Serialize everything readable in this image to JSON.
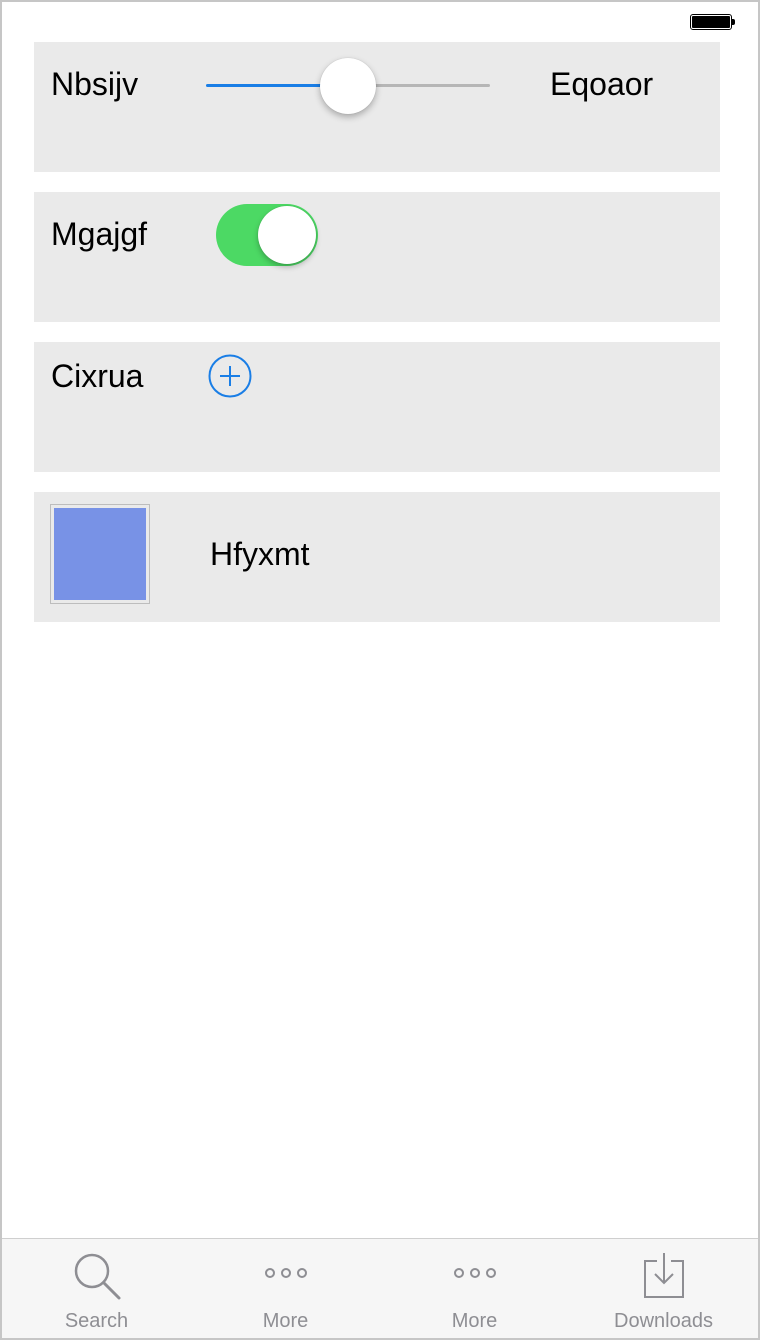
{
  "status_bar": {
    "battery_icon": "battery-full-icon"
  },
  "colors": {
    "accent": "#1a7ee6",
    "switch_on": "#4cd964",
    "card_background": "#eaeaea",
    "thumbnail_fill": "#7892e6",
    "tab_inactive": "#8e8e93"
  },
  "rows": {
    "slider_row": {
      "label": "Nbsijv",
      "value_label": "Eqoaor",
      "slider_value": 0.5
    },
    "switch_row": {
      "label": "Mgajgf",
      "is_on": true
    },
    "add_row": {
      "label": "Cixrua",
      "icon": "plus-circle-icon"
    },
    "image_row": {
      "title": "Hfyxmt"
    }
  },
  "tab_bar": {
    "items": [
      {
        "label": "Search",
        "icon": "search-icon"
      },
      {
        "label": "More",
        "icon": "more-icon"
      },
      {
        "label": "More",
        "icon": "more-icon"
      },
      {
        "label": "Downloads",
        "icon": "downloads-icon"
      }
    ]
  }
}
